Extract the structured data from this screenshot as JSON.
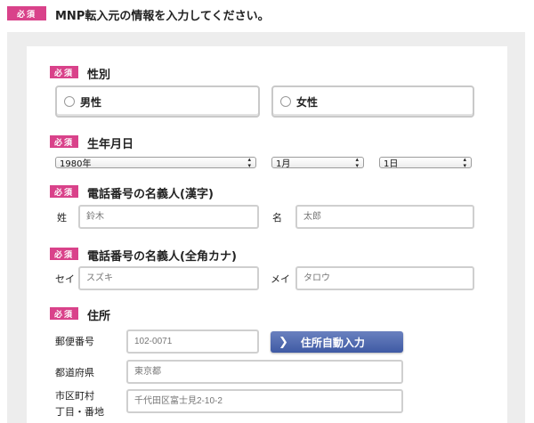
{
  "header": {
    "required_badge": "必須",
    "title": "MNP転入元の情報を入力してください。"
  },
  "gender": {
    "badge": "必須",
    "title": "性別",
    "options": [
      "男性",
      "女性"
    ]
  },
  "birthdate": {
    "badge": "必須",
    "title": "生年月日",
    "year": "1980年",
    "month": "1月",
    "day": "1日"
  },
  "name_kanji": {
    "badge": "必須",
    "title": "電話番号の名義人(漢字)",
    "last_label": "姓",
    "last_placeholder": "鈴木",
    "first_label": "名",
    "first_placeholder": "太郎"
  },
  "name_kana": {
    "badge": "必須",
    "title": "電話番号の名義人(全角カナ)",
    "last_label": "セイ",
    "last_placeholder": "スズキ",
    "first_label": "メイ",
    "first_placeholder": "タロウ"
  },
  "address": {
    "badge": "必須",
    "title": "住所",
    "postal_label": "郵便番号",
    "postal_placeholder": "102-0071",
    "auto_button": "住所自動入力",
    "prefecture_label": "都道府県",
    "prefecture_placeholder": "東京都",
    "city_label_line1": "市区町村",
    "city_label_line2": "丁目・番地",
    "city_placeholder": "千代田区富士見2-10-2"
  },
  "colors": {
    "badge": "#d9428a",
    "button": "#4a63aa",
    "panel_bg": "#ededed"
  }
}
